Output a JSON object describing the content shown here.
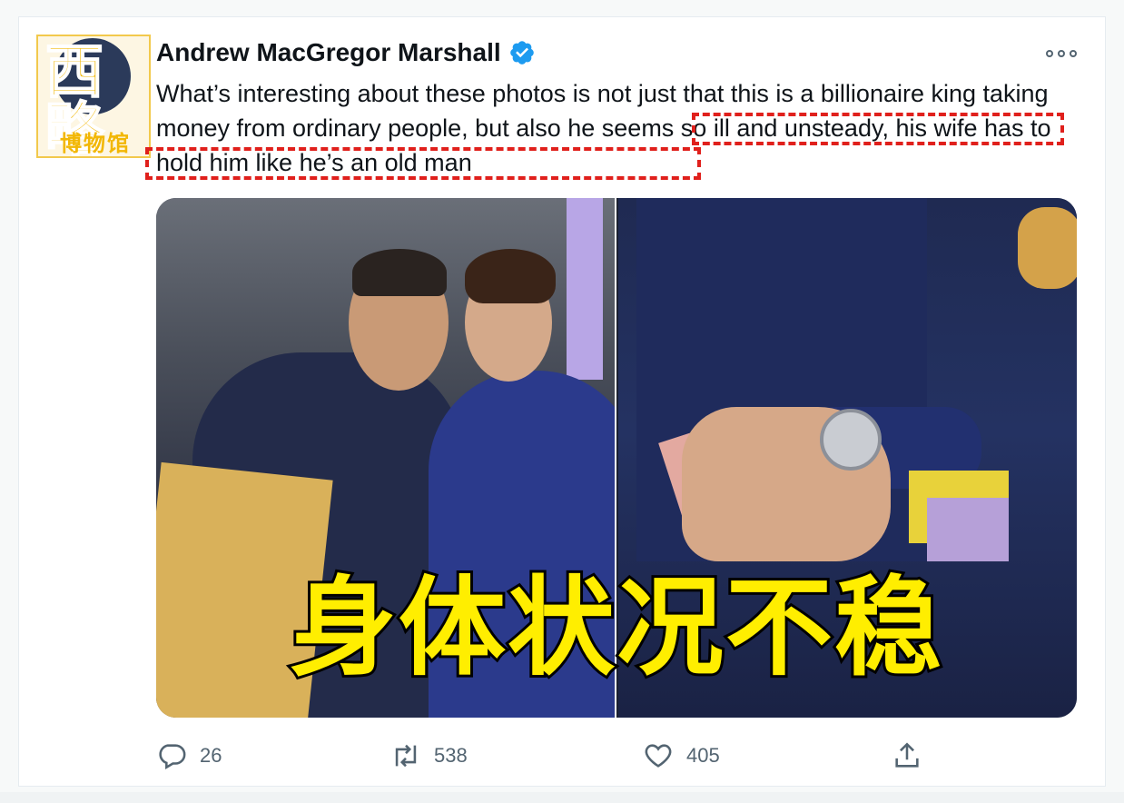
{
  "author": {
    "display_name": "Andrew MacGregor Marshall",
    "verified": true,
    "avatar_watermark_main": "西略",
    "avatar_watermark_sub": "博物馆"
  },
  "tweet": {
    "text_part1": "What’s interesting about these photos is not just that this is a billionaire king taking money from ordinary people, but also ",
    "text_highlight": "he seems so ill and unsteady, his wife has to hold him like he’s an old man"
  },
  "media": {
    "caption": "身体状况不稳"
  },
  "actions": {
    "reply_count": "26",
    "retweet_count": "538",
    "like_count": "405"
  },
  "icons": {
    "reply": "reply-icon",
    "retweet": "retweet-icon",
    "like": "heart-icon",
    "share": "share-icon",
    "more": "more-icon",
    "verified": "verified-badge-icon"
  },
  "colors": {
    "verified": "#1d9bf0",
    "highlight_box": "#e0201c",
    "caption_fill": "#ffee00",
    "action_gray": "#536471"
  }
}
